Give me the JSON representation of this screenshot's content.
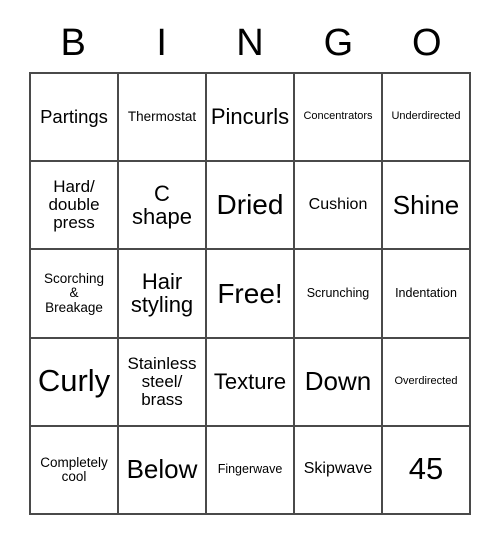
{
  "card": {
    "title_letters": [
      "B",
      "I",
      "N",
      "G",
      "O"
    ],
    "free_space_label": "Free!",
    "border_color": "#4a4a4a",
    "text_color": "#000000",
    "background_color": "#ffffff",
    "rows": 5,
    "columns": 5,
    "cells": [
      {
        "text": "Partings",
        "size": "fs-l"
      },
      {
        "text": "Thermostat",
        "size": "fs-sm"
      },
      {
        "text": "Pincurls",
        "size": "fs-xl"
      },
      {
        "text": "Concentrators",
        "size": "fs-xs"
      },
      {
        "text": "Underdirected",
        "size": "fs-xs"
      },
      {
        "text": "Hard/\ndouble\npress",
        "size": "fs-ml"
      },
      {
        "text": "C\nshape",
        "size": "fs-xl"
      },
      {
        "text": "Dried",
        "size": "fs-h"
      },
      {
        "text": "Cushion",
        "size": "fs-m"
      },
      {
        "text": "Shine",
        "size": "fs-xxl"
      },
      {
        "text": "Scorching\n&\nBreakage",
        "size": "fs-sm"
      },
      {
        "text": "Hair\nstyling",
        "size": "fs-xl"
      },
      {
        "text": "Free!",
        "size": "fs-h"
      },
      {
        "text": "Scrunching",
        "size": "fs-s"
      },
      {
        "text": "Indentation",
        "size": "fs-s"
      },
      {
        "text": "Curly",
        "size": "fs-hh"
      },
      {
        "text": "Stainless\nsteel/\nbrass",
        "size": "fs-ml"
      },
      {
        "text": "Texture",
        "size": "fs-xl"
      },
      {
        "text": "Down",
        "size": "fs-xxl"
      },
      {
        "text": "Overdirected",
        "size": "fs-xs"
      },
      {
        "text": "Completely\ncool",
        "size": "fs-sm"
      },
      {
        "text": "Below",
        "size": "fs-xxl"
      },
      {
        "text": "Fingerwave",
        "size": "fs-s"
      },
      {
        "text": "Skipwave",
        "size": "fs-m"
      },
      {
        "text": "45",
        "size": "fs-hh"
      }
    ]
  }
}
